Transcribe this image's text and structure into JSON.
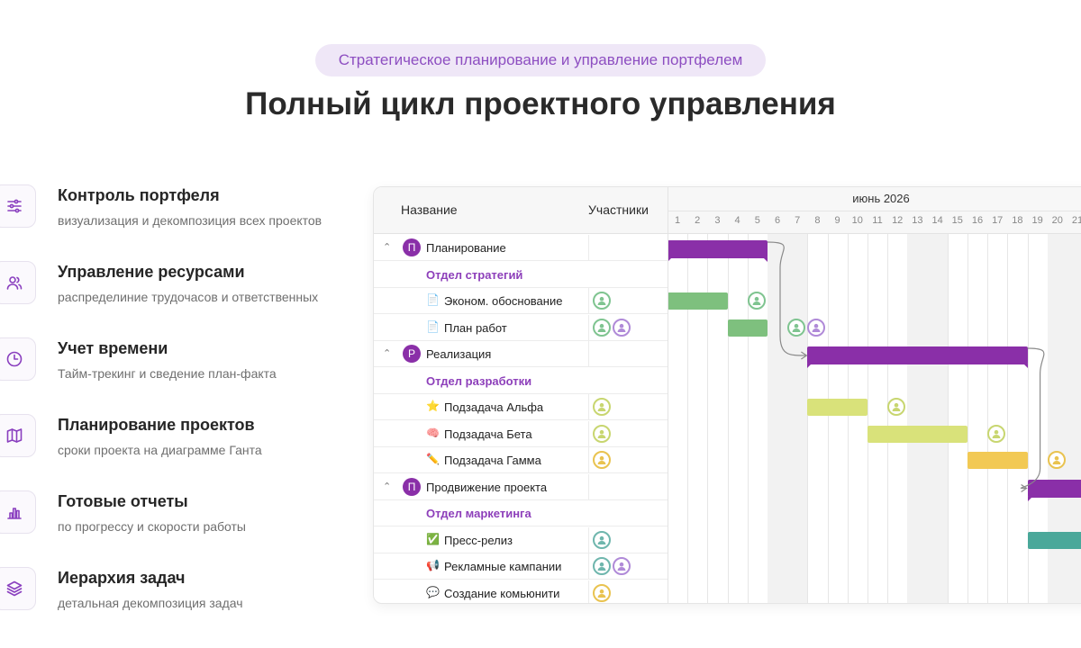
{
  "badge": "Стратегическое планирование и управление портфелем",
  "headline": "Полный цикл проектного управления",
  "features": [
    {
      "icon": "sliders-icon",
      "title": "Контроль портфеля",
      "desc": "визуализация и декомпозиция всех проектов"
    },
    {
      "icon": "users-icon",
      "title": "Управление ресурсами",
      "desc": "распределиние трудочасов и ответственных"
    },
    {
      "icon": "clock-icon",
      "title": "Учет времени",
      "desc": "Тайм-трекинг и сведение план-факта"
    },
    {
      "icon": "map-icon",
      "title": "Планирование проектов",
      "desc": "сроки проекта на диаграмме Ганта"
    },
    {
      "icon": "bar-chart-icon",
      "title": "Готовые отчеты",
      "desc": "по прогрессу и скорости работы"
    },
    {
      "icon": "layers-icon",
      "title": "Иерархия задач",
      "desc": "детальная декомпозиция задач"
    }
  ],
  "gantt": {
    "col_name": "Название",
    "col_participants": "Участники",
    "month": "июнь 2026",
    "days": [
      "1",
      "2",
      "3",
      "4",
      "5",
      "6",
      "7",
      "8",
      "9",
      "10",
      "11",
      "12",
      "13",
      "14",
      "15",
      "16",
      "17",
      "18",
      "19",
      "20",
      "21"
    ],
    "rows": [
      {
        "kind": "project",
        "badge": "П",
        "title": "Планирование",
        "start": 1,
        "end": 5
      },
      {
        "kind": "dept",
        "title": "Отдел стратегий"
      },
      {
        "kind": "task",
        "icon": "📄",
        "title": "Эконом. обоснование",
        "start": 1,
        "end": 3,
        "color": "#7ec07e",
        "avatars": [
          "#7fc490"
        ]
      },
      {
        "kind": "task",
        "icon": "📄",
        "title": "План работ",
        "start": 4,
        "end": 5,
        "color": "#7ec07e",
        "avatars": [
          "#7fc490",
          "#b08ad8"
        ]
      },
      {
        "kind": "project",
        "badge": "Р",
        "title": "Реализация",
        "start": 8,
        "end": 18
      },
      {
        "kind": "dept",
        "title": "Отдел разработки"
      },
      {
        "kind": "task",
        "icon": "⭐",
        "title": "Подзадача Альфа",
        "start": 8,
        "end": 10,
        "color": "#d9e27a",
        "avatars": [
          "#c8d670"
        ]
      },
      {
        "kind": "task",
        "icon": "🧠",
        "title": "Подзадача Бета",
        "start": 11,
        "end": 15,
        "color": "#d9e27a",
        "avatars": [
          "#c8d670"
        ]
      },
      {
        "kind": "task",
        "icon": "✏️",
        "title": "Подзадача Гамма",
        "start": 16,
        "end": 18,
        "color": "#f2c954",
        "avatars": [
          "#e9c350"
        ]
      },
      {
        "kind": "project",
        "badge": "П",
        "title": "Продвижение проекта",
        "start": 19,
        "end": 21
      },
      {
        "kind": "dept",
        "title": "Отдел маркетинга"
      },
      {
        "kind": "task",
        "icon": "✅",
        "title": "Пресс-релиз",
        "start": 19,
        "end": 21,
        "color": "#4aa89a",
        "avatars": [
          "#6fb6ad"
        ]
      },
      {
        "kind": "task",
        "icon": "📢",
        "title": "Рекламные кампании",
        "avatars": [
          "#6fb6ad",
          "#b08ad8"
        ]
      },
      {
        "kind": "task",
        "icon": "💬",
        "title": "Создание комьюнити",
        "avatars": [
          "#e9c350"
        ]
      }
    ]
  },
  "colors": {
    "accent": "#8a2fa8",
    "weekend": "#f2f2f2"
  }
}
